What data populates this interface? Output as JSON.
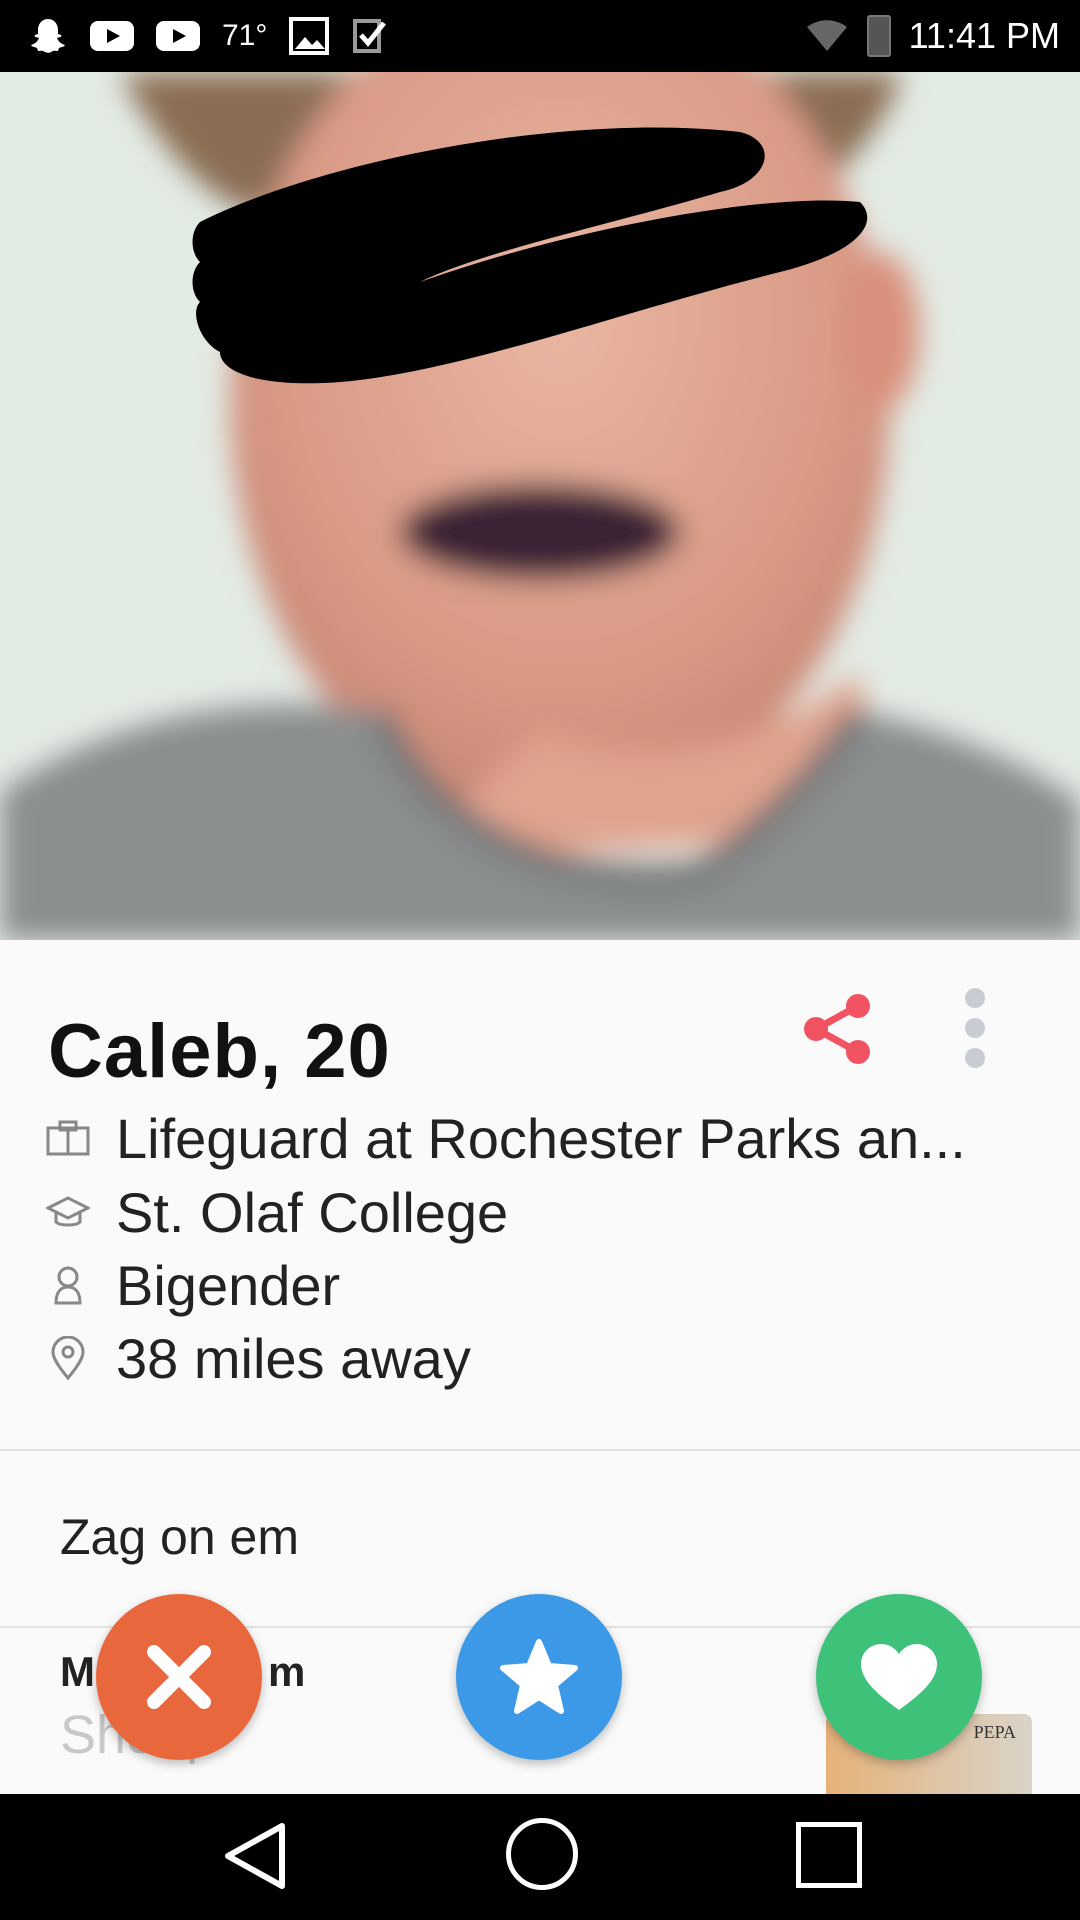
{
  "status_bar": {
    "temperature": "71°",
    "time": "11:41 PM",
    "icons": [
      "snapchat-icon",
      "youtube-icon",
      "youtube-icon",
      "image-icon",
      "checklist-icon",
      "wifi-icon",
      "battery-icon"
    ]
  },
  "profile": {
    "name_age": "Caleb, 20",
    "details": {
      "job": "Lifeguard at Rochester Parks an...",
      "school": "St. Olaf College",
      "gender": "Bigender",
      "distance": "38 miles away"
    },
    "bio": "Zag on em"
  },
  "music": {
    "title_partial": "M",
    "title_suffix": "m",
    "subtitle_partial": "Shoop",
    "album_label": "PEPA"
  },
  "colors": {
    "nope": "#e8673c",
    "super_like": "#3b99e8",
    "like": "#3ec27a",
    "share": "#f25362"
  }
}
